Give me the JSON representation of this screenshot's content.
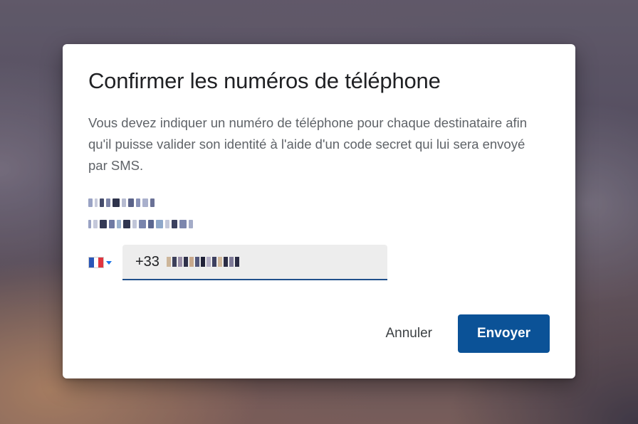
{
  "dialog": {
    "title": "Confirmer les numéros de téléphone",
    "description": "Vous devez indiquer un numéro de téléphone pour chaque destinataire afin qu'il puisse valider son identité à l'aide d'un code secret qui lui sera envoyé par SMS.",
    "recipient": {
      "name": "[pixelated name]",
      "email": "[pixelated email]"
    },
    "phone": {
      "country_flag": "france-flag-icon",
      "prefix": "+33",
      "number": "[pixelated number]"
    },
    "buttons": {
      "cancel_label": "Annuler",
      "send_label": "Envoyer"
    }
  },
  "colors": {
    "primary_button": "#0b5297",
    "field_underline": "#1f4f8b",
    "field_background": "#ededed",
    "caret": "#1a73e8"
  }
}
